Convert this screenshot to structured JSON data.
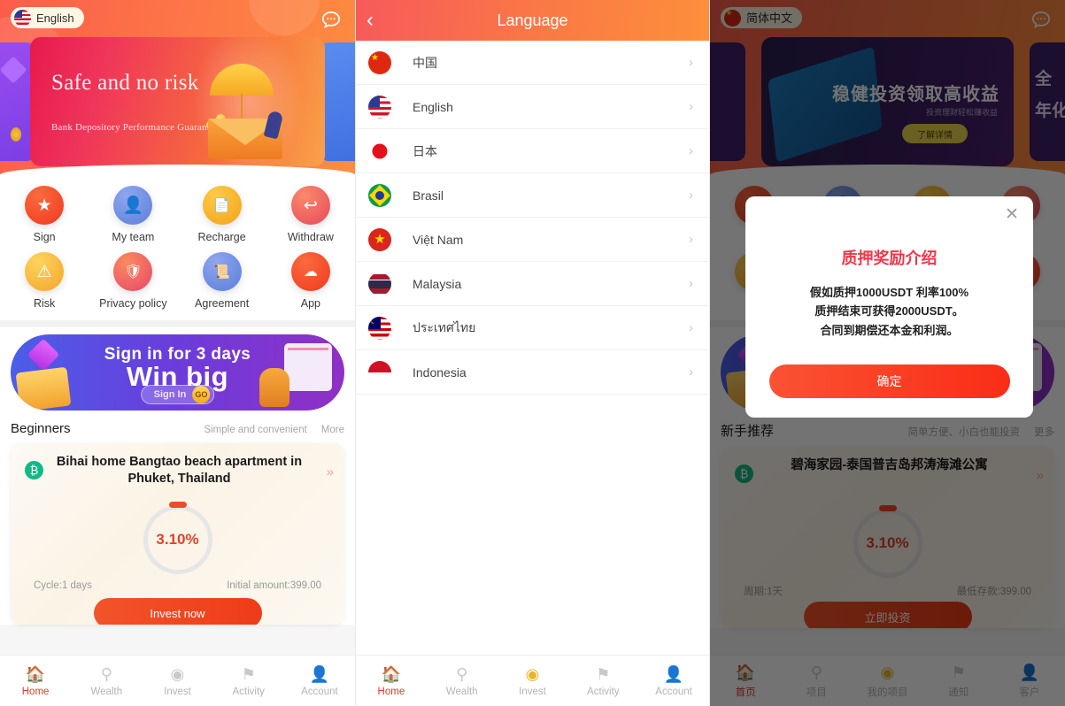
{
  "left_panel": {
    "language_badge": {
      "label": "English",
      "flag": "flag-usa-icon"
    },
    "chat_icon": "chat-bubble-icon",
    "banner": {
      "title": "Safe and no risk",
      "subtitle": "Bank Depository Performance Guarantee",
      "dots_active_index": 2,
      "dots_count": 3
    },
    "quick_actions": [
      {
        "label": "Sign",
        "icon": "star-icon",
        "color": "#f4502e"
      },
      {
        "label": "My team",
        "icon": "users-icon",
        "color": "#6d8de0"
      },
      {
        "label": "Recharge",
        "icon": "receipt-icon",
        "color": "#f7b428"
      },
      {
        "label": "Withdraw",
        "icon": "reply-arrow-icon",
        "color": "#ef5a53"
      },
      {
        "label": "Risk",
        "icon": "warning-icon",
        "color": "#f9b42b"
      },
      {
        "label": "Privacy policy",
        "icon": "shield-lock-icon",
        "color": "#ef5a53"
      },
      {
        "label": "Agreement",
        "icon": "document-icon",
        "color": "#6d8de0"
      },
      {
        "label": "App",
        "icon": "cloud-download-icon",
        "color": "#f4502e"
      }
    ],
    "promo": {
      "line1": "Sign in for 3 days",
      "line2": "Win big",
      "button_label": "Sign In",
      "go_label": "GO"
    },
    "section": {
      "title": "Beginners",
      "subtitle": "Simple and convenient",
      "more": "More"
    },
    "product": {
      "coin_icon": "bitcoin-icon",
      "title": "Bihai home Bangtao beach apartment in Phuket, Thailand",
      "chevron": "double-chevron-right-icon",
      "rate": "3.10%",
      "cycle": "Cycle:1 days",
      "initial": "Initial amount:399.00",
      "cta_label": "Invest now"
    },
    "tabs": [
      {
        "label": "Home",
        "icon": "home-icon",
        "state": "active"
      },
      {
        "label": "Wealth",
        "icon": "vase-icon",
        "state": "inactive"
      },
      {
        "label": "Invest",
        "icon": "coins-icon",
        "state": "inactive"
      },
      {
        "label": "Activity",
        "icon": "flag-icon",
        "state": "inactive"
      },
      {
        "label": "Account",
        "icon": "person-icon",
        "state": "inactive"
      }
    ]
  },
  "mid_panel": {
    "header": {
      "title": "Language",
      "back_icon": "chevron-left-icon"
    },
    "languages": [
      {
        "name": "中国",
        "flag": "flag-china-icon",
        "flag_class": "f-cn"
      },
      {
        "name": "English",
        "flag": "flag-usa-icon",
        "flag_class": "f-us"
      },
      {
        "name": "日本",
        "flag": "flag-japan-icon",
        "flag_class": "f-jp"
      },
      {
        "name": "Brasil",
        "flag": "flag-brazil-icon",
        "flag_class": "f-br"
      },
      {
        "name": "Việt Nam",
        "flag": "flag-vietnam-icon",
        "flag_class": "f-vn"
      },
      {
        "name": "Malaysia",
        "flag": "flag-thailand-icon",
        "flag_class": "f-th"
      },
      {
        "name": "ประเทศไทย",
        "flag": "flag-malaysia-icon",
        "flag_class": "f-my"
      },
      {
        "name": "Indonesia",
        "flag": "flag-indonesia-icon",
        "flag_class": "f-id"
      }
    ],
    "arrow_icon": "chevron-right-icon",
    "tabs": [
      {
        "label": "Home",
        "icon": "home-icon",
        "state": "active"
      },
      {
        "label": "Wealth",
        "icon": "vase-icon",
        "state": "inactive"
      },
      {
        "label": "Invest",
        "icon": "coins-icon",
        "state": "gold"
      },
      {
        "label": "Activity",
        "icon": "flag-icon",
        "state": "inactive"
      },
      {
        "label": "Account",
        "icon": "person-icon",
        "state": "inactive"
      }
    ]
  },
  "right_panel": {
    "language_badge": {
      "label": "简体中文",
      "flag": "flag-china-icon"
    },
    "chat_icon": "chat-bubble-icon",
    "banner": {
      "title": "稳健投资领取高收益",
      "subtitle": "投资理财轻松赚收益",
      "button_label": "了解详情",
      "side_text": "全\n年化"
    },
    "quick_actions": [
      {
        "label": "",
        "color": "#f4502e"
      },
      {
        "label": "",
        "color": "#6d8de0"
      },
      {
        "label": "",
        "color": "#f7b428"
      },
      {
        "label": "",
        "color": "#ef5a53"
      }
    ],
    "section": {
      "title": "新手推荐",
      "subtitle": "简单方便、小白也能投资",
      "more": "更多"
    },
    "product": {
      "title": "碧海家园-泰国普吉岛邦涛海滩公寓",
      "rate": "3.10%",
      "cycle": "周期:1天",
      "initial": "最低存款:399.00",
      "cta_label": "立即投资"
    },
    "modal": {
      "close_icon": "close-icon",
      "title": "质押奖励介绍",
      "line1": "假如质押1000USDT 利率100%",
      "line2": "质押结束可获得2000USDT。",
      "line3": "合同到期偿还本金和利润。",
      "confirm_label": "确定"
    },
    "tabs": [
      {
        "label": "首页",
        "icon": "home-icon",
        "state": "active"
      },
      {
        "label": "项目",
        "icon": "vase-icon",
        "state": "inactive"
      },
      {
        "label": "我的项目",
        "icon": "coins-icon",
        "state": "gold"
      },
      {
        "label": "通知",
        "icon": "flag-icon",
        "state": "inactive"
      },
      {
        "label": "客户",
        "icon": "person-icon",
        "state": "inactive"
      }
    ]
  }
}
